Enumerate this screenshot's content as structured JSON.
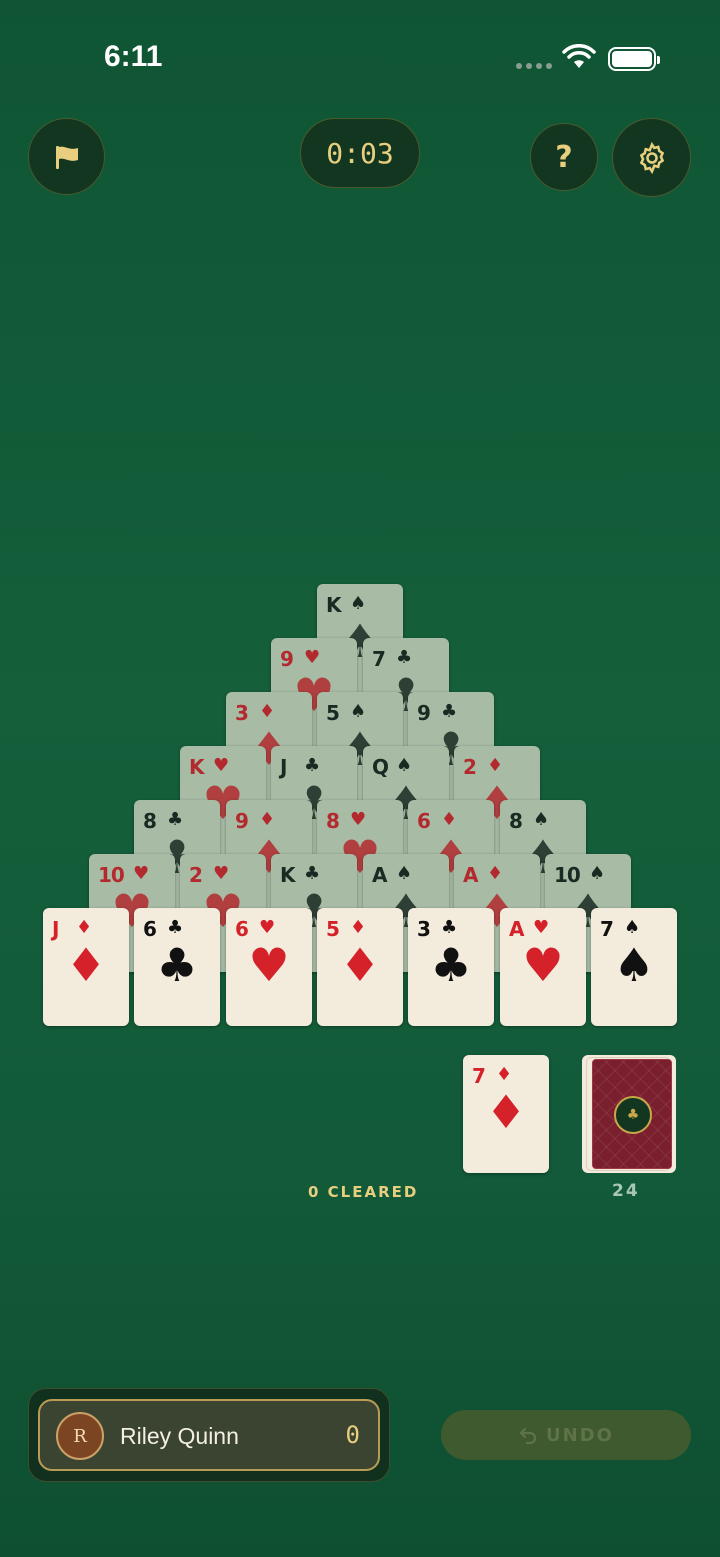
{
  "status": {
    "time": "6:11"
  },
  "header": {
    "flag_icon": "flag-icon",
    "timer": "0:03",
    "help_label": "?",
    "settings_icon": "gear-icon"
  },
  "pyramid": [
    [
      {
        "rank": "K",
        "suit": "♠",
        "color": "black"
      }
    ],
    [
      {
        "rank": "9",
        "suit": "♥",
        "color": "red"
      },
      {
        "rank": "7",
        "suit": "♣",
        "color": "black"
      }
    ],
    [
      {
        "rank": "3",
        "suit": "♦",
        "color": "red"
      },
      {
        "rank": "5",
        "suit": "♠",
        "color": "black"
      },
      {
        "rank": "9",
        "suit": "♣",
        "color": "black"
      }
    ],
    [
      {
        "rank": "K",
        "suit": "♥",
        "color": "red"
      },
      {
        "rank": "J",
        "suit": "♣",
        "color": "black"
      },
      {
        "rank": "Q",
        "suit": "♠",
        "color": "black"
      },
      {
        "rank": "2",
        "suit": "♦",
        "color": "red"
      }
    ],
    [
      {
        "rank": "8",
        "suit": "♣",
        "color": "black"
      },
      {
        "rank": "9",
        "suit": "♦",
        "color": "red"
      },
      {
        "rank": "8",
        "suit": "♥",
        "color": "red"
      },
      {
        "rank": "6",
        "suit": "♦",
        "color": "red"
      },
      {
        "rank": "8",
        "suit": "♠",
        "color": "black"
      }
    ],
    [
      {
        "rank": "10",
        "suit": "♥",
        "color": "red"
      },
      {
        "rank": "2",
        "suit": "♥",
        "color": "red"
      },
      {
        "rank": "K",
        "suit": "♣",
        "color": "black"
      },
      {
        "rank": "A",
        "suit": "♠",
        "color": "black"
      },
      {
        "rank": "A",
        "suit": "♦",
        "color": "red"
      },
      {
        "rank": "10",
        "suit": "♠",
        "color": "black"
      }
    ],
    [
      {
        "rank": "J",
        "suit": "♦",
        "color": "red"
      },
      {
        "rank": "6",
        "suit": "♣",
        "color": "black"
      },
      {
        "rank": "6",
        "suit": "♥",
        "color": "red"
      },
      {
        "rank": "5",
        "suit": "♦",
        "color": "red"
      },
      {
        "rank": "3",
        "suit": "♣",
        "color": "black"
      },
      {
        "rank": "A",
        "suit": "♥",
        "color": "red"
      },
      {
        "rank": "7",
        "suit": "♠",
        "color": "black"
      }
    ]
  ],
  "waste": {
    "rank": "7",
    "suit": "♦",
    "color": "red"
  },
  "cleared_label": "0 CLEARED",
  "stock_count": "24",
  "deck_emblem": "♣",
  "player": {
    "initial": "R",
    "name": "Riley Quinn",
    "score": "0"
  },
  "undo_label": "UNDO",
  "colors": {
    "felt": "#155f3b",
    "gold": "#e8cf80",
    "card": "#f3ecdc",
    "covered_card": "#a7bba5",
    "red": "#d4212a"
  }
}
